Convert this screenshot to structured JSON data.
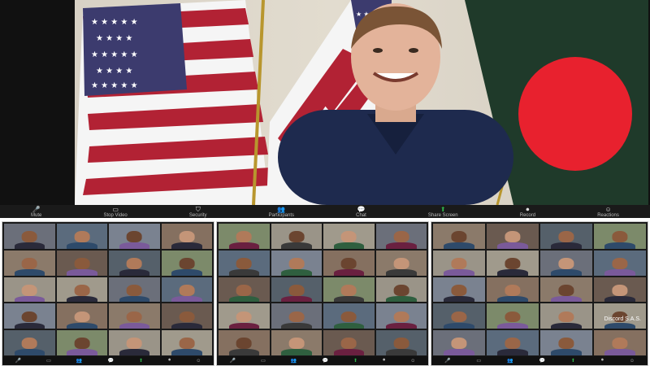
{
  "meeting": {
    "toolbar": [
      {
        "label": "Mute",
        "icon": "microphone-icon",
        "glyph": "🎤",
        "color": ""
      },
      {
        "label": "Stop Video",
        "icon": "video-camera-icon",
        "glyph": "▭",
        "color": ""
      },
      {
        "label": "Security",
        "icon": "shield-icon",
        "glyph": "⛉",
        "color": ""
      },
      {
        "label": "Participants",
        "icon": "participants-icon",
        "glyph": "👥",
        "color": ""
      },
      {
        "label": "Chat",
        "icon": "chat-icon",
        "glyph": "💬",
        "color": "red"
      },
      {
        "label": "Share Screen",
        "icon": "share-screen-icon",
        "glyph": "⬆",
        "color": "green"
      },
      {
        "label": "Record",
        "icon": "record-icon",
        "glyph": "⏺",
        "color": ""
      },
      {
        "label": "Reactions",
        "icon": "reactions-icon",
        "glyph": "☺",
        "color": ""
      }
    ],
    "overlay_name": "Discord S.A.S."
  },
  "colors": {
    "toolbar_bg": "#1a1a1a",
    "green": "#2fb34a",
    "flag_red": "#b22234",
    "flag_blue": "#3c3b6e",
    "bd_green": "#006a4e",
    "bd_red": "#f42a41"
  },
  "panes": [
    {
      "tiles": 20
    },
    {
      "tiles": 20
    },
    {
      "tiles": 20
    }
  ]
}
